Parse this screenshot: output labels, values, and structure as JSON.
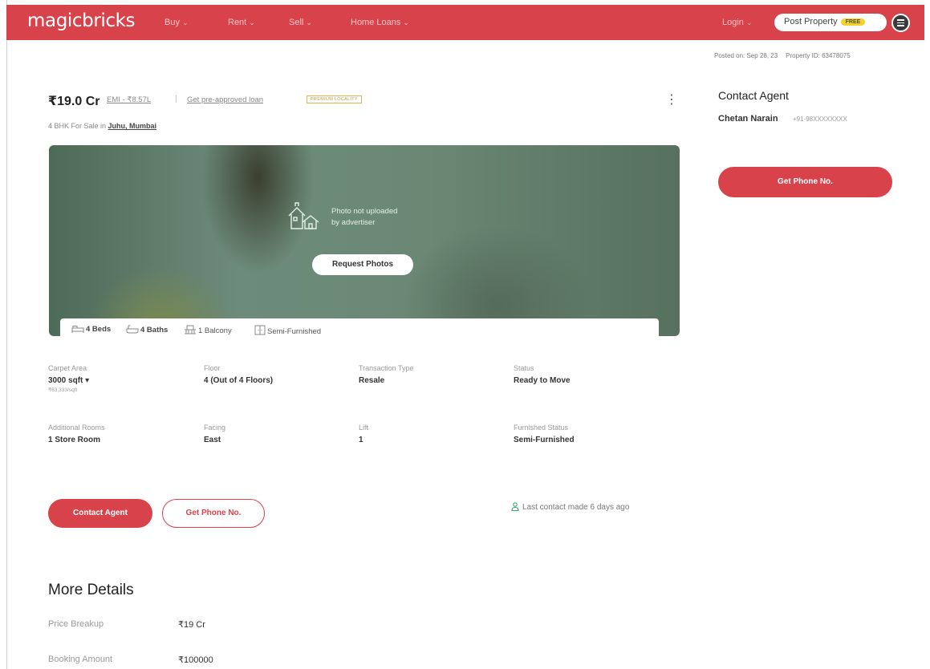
{
  "header": {
    "logo": "magicbricks",
    "nav": [
      {
        "label": "Buy"
      },
      {
        "label": "Rent"
      },
      {
        "label": "Sell"
      },
      {
        "label": "Home Loans"
      }
    ],
    "login_label": "Login",
    "post_property_label": "Post Property",
    "free_badge": "FREE"
  },
  "meta": {
    "posted_on": "Posted on: Sep 28, 23",
    "property_id": "Property ID: 63478075"
  },
  "listing": {
    "price": "₹19.0 Cr",
    "emi": "EMI - ₹8.57L",
    "separator": "|",
    "preapproved_loan": "Get pre-approved loan",
    "premium_badge": "PREMIUM LOCALITY",
    "subtitle_prefix": "4 BHK For Sale in",
    "locality": "Juhu, Mumbai",
    "photo_note_line1": "Photo not uploaded",
    "photo_note_line2": "by advertiser",
    "request_photos": "Request Photos",
    "features": {
      "beds": "4 Beds",
      "baths": "4 Baths",
      "balcony": "1 Balcony",
      "furnishing": "Semi-Furnished"
    },
    "details": [
      {
        "label": "Carpet Area",
        "value": "3000 sqft ▾",
        "sub": "₹63,333/sqft"
      },
      {
        "label": "Floor",
        "value": "4 (Out of 4 Floors)"
      },
      {
        "label": "Transaction Type",
        "value": "Resale"
      },
      {
        "label": "Status",
        "value": "Ready to Move"
      },
      {
        "label": "Additional Rooms",
        "value": "1 Store Room"
      },
      {
        "label": "Facing",
        "value": "East"
      },
      {
        "label": "Lift",
        "value": "1"
      },
      {
        "label": "Furnished Status",
        "value": "Semi-Furnished"
      }
    ],
    "contact_agent_btn": "Contact Agent",
    "get_phone_btn": "Get Phone No.",
    "last_contact": "Last contact made 6 days ago"
  },
  "more_details": {
    "title": "More Details",
    "rows": [
      {
        "label": "Price Breakup",
        "value": "₹19 Cr"
      },
      {
        "label": "Booking Amount",
        "value": "₹100000"
      }
    ]
  },
  "sidebar": {
    "title": "Contact Agent",
    "agent_name": "Chetan Narain",
    "agent_phone": "+91-98XXXXXXXX",
    "get_phone_btn": "Get Phone No."
  },
  "colors": {
    "brand": "#d8424a",
    "free_badge": "#f2d22c",
    "photo_tint": "#6a8874"
  }
}
